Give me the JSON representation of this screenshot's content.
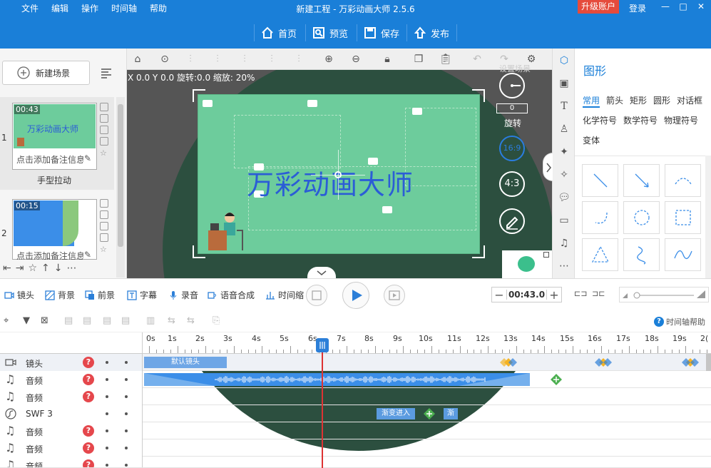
{
  "app": {
    "title": "新建工程 - 万彩动画大师 2.5.6",
    "menu": [
      "文件",
      "编辑",
      "操作",
      "时间轴",
      "帮助"
    ],
    "upgrade": "升级账户",
    "login": "登录"
  },
  "toolbar": {
    "home": "首页",
    "preview": "预览",
    "save": "保存",
    "publish": "发布"
  },
  "left_panel": {
    "new_scene": "新建场景",
    "scenes": [
      {
        "num": "1",
        "time": "00:43",
        "thumb_text": "万彩动画大师",
        "note": "点击添加备注信息",
        "name": "手型拉动"
      },
      {
        "num": "2",
        "time": "00:15",
        "note": "点击添加备注信息"
      }
    ]
  },
  "canvas": {
    "coords": "X 0.0 Y 0.0 旋转:0.0 缩放: 20%",
    "stage_text": "万彩动画大师",
    "top_label": "设置场景",
    "rotate_value": "0",
    "rotate_label": "旋转",
    "ratio_169": "16:9",
    "ratio_43": "4:3"
  },
  "shape_panel": {
    "title": "图形",
    "tabs": [
      "常用",
      "箭头",
      "矩形",
      "圆形",
      "对话框",
      "化学符号",
      "数学符号",
      "物理符号",
      "变体"
    ]
  },
  "timeline_controls": {
    "items": [
      "镜头",
      "背景",
      "前景",
      "字幕",
      "录音",
      "语音合成",
      "时间缩"
    ],
    "time": "00:43.0",
    "help": "时间轴帮助"
  },
  "ruler": [
    "0s",
    "1s",
    "2s",
    "3s",
    "4s",
    "5s",
    "6s",
    "7s",
    "8s",
    "9s",
    "10s",
    "11s",
    "12s",
    "13s",
    "14s",
    "15s",
    "16s",
    "17s",
    "18s",
    "19s",
    "2("
  ],
  "tracks": [
    {
      "name": "镜头",
      "icon": "camera-icon",
      "help": true,
      "clips": [
        {
          "label": "默认镜头"
        }
      ]
    },
    {
      "name": "音频",
      "icon": "music-icon",
      "help": true
    },
    {
      "name": "音频",
      "icon": "music-icon",
      "help": true
    },
    {
      "name": "SWF 3",
      "icon": "swf-icon",
      "help": false,
      "clips": [
        {
          "label": "渐变进入"
        },
        {
          "label": "渐"
        }
      ]
    },
    {
      "name": "音频",
      "icon": "music-icon",
      "help": true
    },
    {
      "name": "音频",
      "icon": "music-icon",
      "help": true
    },
    {
      "name": "音频",
      "icon": "music-icon",
      "help": true
    }
  ],
  "colors": {
    "brand": "#1a7fd8",
    "stage": "#6dcc9c",
    "stage_text": "#2b5dd6",
    "danger": "#e5474c"
  }
}
